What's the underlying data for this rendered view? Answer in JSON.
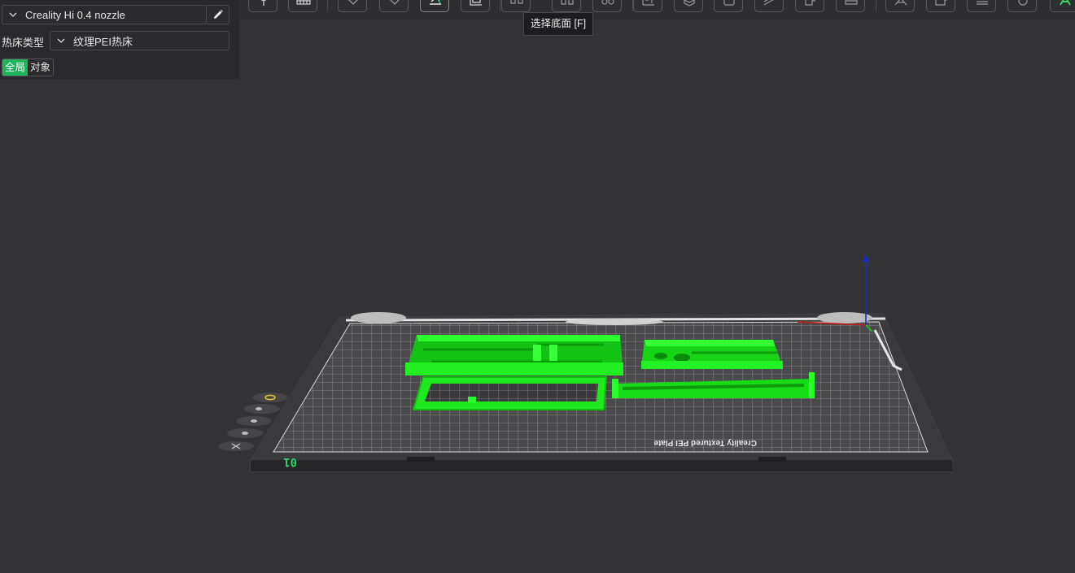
{
  "settings": {
    "printer": "Creality Hi 0.4 nozzle",
    "bed_label": "热床类型",
    "bed_type": "纹理PEI热床",
    "scope_tabs": [
      {
        "label": "全局",
        "active": true
      },
      {
        "label": "对象",
        "active": false
      }
    ]
  },
  "toolbar": {
    "tooltip": "选择底面 [F]",
    "icons": [
      "view-cube-icon",
      "plate-grid-icon",
      "add-plate-icon",
      "orient-icon",
      "lay-on-face-icon",
      "arrange-icon",
      "split-icon",
      "assembly-icon",
      "support-painting-icon",
      "move-icon",
      "rotate-icon",
      "scale-icon",
      "cut-icon",
      "seam-icon",
      "variable-layer-icon",
      "emboss-icon",
      "measure-icon",
      "brim-ears-icon",
      "color-paint-icon",
      "layers-icon",
      "mesh-boolean-icon",
      "text-icon"
    ]
  },
  "viewport": {
    "plate_label": "01",
    "bed_brand": "Creality Textured PEI Plate",
    "side_toolbar": [
      "home-icon",
      "zoom-icon",
      "orbit-icon",
      "pan-icon",
      "close-icon"
    ]
  },
  "colors": {
    "background": "#333335",
    "panel": "#2a2a2c",
    "accent": "#1fb35a",
    "model": "#1ef01e"
  }
}
